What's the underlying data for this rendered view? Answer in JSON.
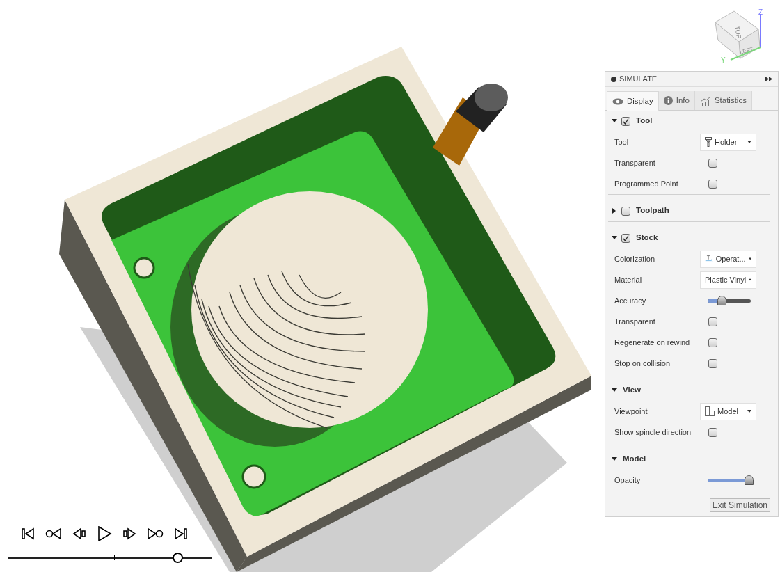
{
  "view_cube": {
    "top_face": "TOP",
    "left_face": "LEFT",
    "z_axis": "Z",
    "y_axis": "Y"
  },
  "panel": {
    "title": "SIMULATE",
    "tabs": [
      {
        "label": "Display",
        "selected": true
      },
      {
        "label": "Info",
        "selected": false
      },
      {
        "label": "Statistics",
        "selected": false
      }
    ],
    "sections": [
      {
        "title": "Tool",
        "expanded": true,
        "checked": true,
        "rows": [
          {
            "kind": "dropdown",
            "label": "Tool",
            "value": "Holder"
          },
          {
            "kind": "checkbox",
            "label": "Transparent",
            "checked": false
          },
          {
            "kind": "checkbox",
            "label": "Programmed Point",
            "checked": false
          }
        ]
      },
      {
        "title": "Toolpath",
        "expanded": false,
        "checked": false
      },
      {
        "title": "Stock",
        "expanded": true,
        "checked": true,
        "rows": [
          {
            "kind": "dropdown",
            "label": "Colorization",
            "value": "Operat..."
          },
          {
            "kind": "dropdown",
            "label": "Material",
            "value": "Plastic Vinyl"
          },
          {
            "kind": "slider",
            "label": "Accuracy",
            "level": 0.33
          },
          {
            "kind": "checkbox",
            "label": "Transparent",
            "checked": false
          },
          {
            "kind": "checkbox",
            "label": "Regenerate on rewind",
            "checked": false
          },
          {
            "kind": "checkbox",
            "label": "Stop on collision",
            "checked": false
          }
        ]
      },
      {
        "title": "View",
        "expanded": true,
        "rows": [
          {
            "kind": "dropdown",
            "label": "Viewpoint",
            "value": "Model"
          },
          {
            "kind": "checkbox",
            "label": "Show spindle direction",
            "checked": false
          }
        ]
      },
      {
        "title": "Model",
        "expanded": true,
        "rows": [
          {
            "kind": "slider",
            "label": "Opacity",
            "level": 0.95
          }
        ]
      }
    ],
    "exit_button": "Exit Simulation"
  },
  "playback": {
    "level": 0.83
  }
}
